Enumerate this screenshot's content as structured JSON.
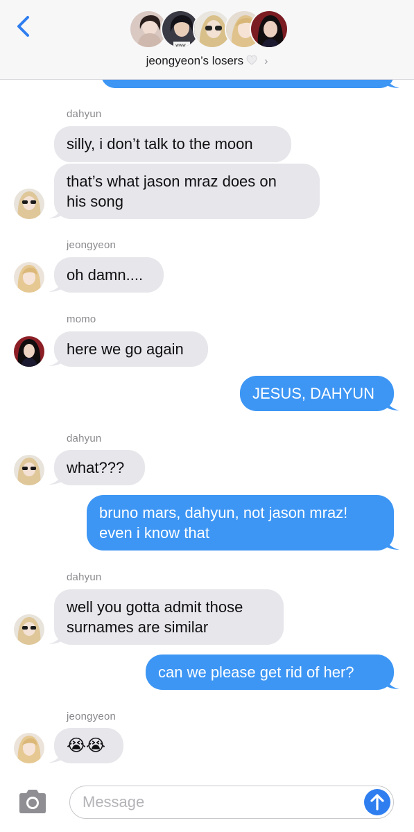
{
  "header": {
    "back_icon": "chevron-left-icon",
    "group_name": "jeongyeon’s losers",
    "heart_icon": "white-heart-icon",
    "disclosure": "›",
    "avatar_count": 5
  },
  "messages": [
    {
      "sender": "dahyun",
      "direction": "incoming",
      "text": "silly, i don’t talk to the moon"
    },
    {
      "direction": "incoming",
      "lines": [
        "that’s what jason mraz does on",
        "his song"
      ]
    },
    {
      "sender": "jeongyeon",
      "direction": "incoming",
      "text": "oh damn...."
    },
    {
      "sender": "momo",
      "direction": "incoming",
      "text": "here we go again"
    },
    {
      "direction": "outgoing",
      "text": "JESUS, DAHYUN"
    },
    {
      "sender": "dahyun",
      "direction": "incoming",
      "text": "what???"
    },
    {
      "direction": "outgoing",
      "lines": [
        "bruno mars, dahyun, not jason mraz!",
        "even i know that"
      ]
    },
    {
      "sender": "dahyun",
      "direction": "incoming",
      "lines": [
        "well you gotta admit those",
        "surnames are similar"
      ]
    },
    {
      "direction": "outgoing",
      "text": "can we please get rid of her?"
    },
    {
      "sender": "jeongyeon",
      "direction": "incoming",
      "text": "😭😭"
    }
  ],
  "input": {
    "placeholder": "Message",
    "camera_icon": "camera-icon",
    "send_icon": "arrow-up-icon"
  },
  "colors": {
    "outgoing_bubble": "#3d96f4",
    "incoming_bubble": "#e6e6eb",
    "accent": "#2f7ef0",
    "header_bg": "#f7f7f8"
  }
}
